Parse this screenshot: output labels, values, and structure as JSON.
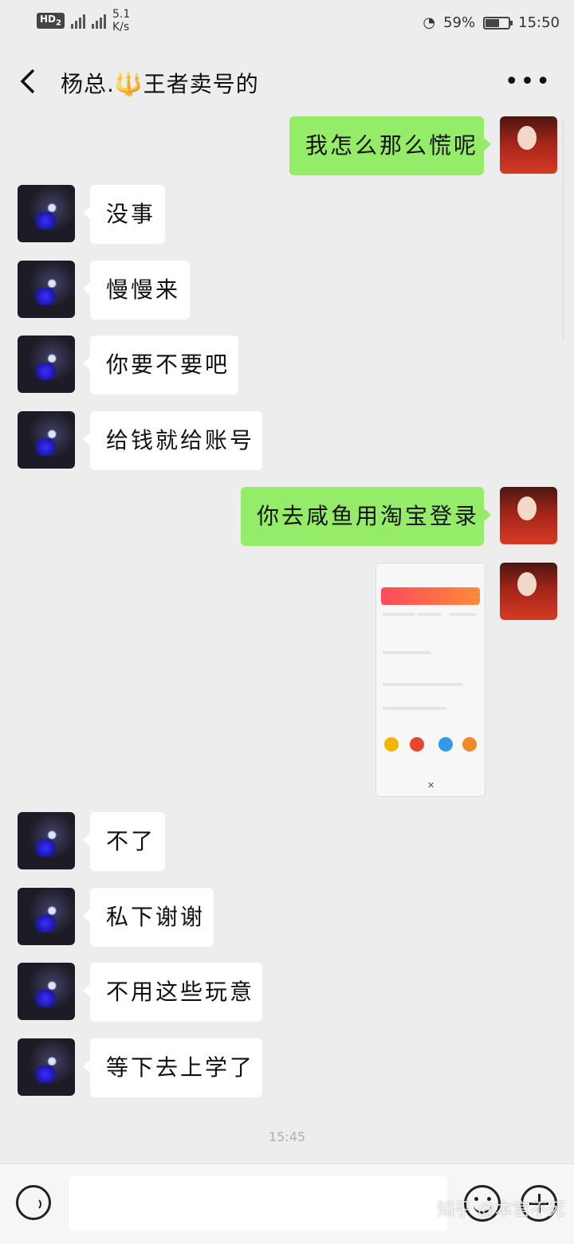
{
  "status": {
    "network": "HD",
    "net_sub": "2",
    "speed_value": "5.1",
    "speed_unit": "K/s",
    "battery": "59%",
    "time": "15:50"
  },
  "header": {
    "title": "杨总.🔱王者卖号的"
  },
  "messages": [
    {
      "side": "out",
      "text": "我怎么那么慌呢"
    },
    {
      "side": "in",
      "text": "没事"
    },
    {
      "side": "in",
      "text": "慢慢来"
    },
    {
      "side": "in",
      "text": "你要不要吧"
    },
    {
      "side": "in",
      "text": "给钱就给账号"
    },
    {
      "side": "out",
      "text": "你去咸鱼用淘宝登录"
    },
    {
      "side": "out",
      "type": "image"
    },
    {
      "side": "in",
      "text": "不了"
    },
    {
      "side": "in",
      "text": "私下谢谢"
    },
    {
      "side": "in",
      "text": "不用这些玩意"
    },
    {
      "side": "in",
      "text": "等下去上学了"
    }
  ],
  "timestamp": "15:45",
  "watermark": "知乎 @本宫不死",
  "colors": {
    "outgoing_bubble": "#95ec69",
    "incoming_bubble": "#ffffff",
    "background": "#ededed"
  }
}
